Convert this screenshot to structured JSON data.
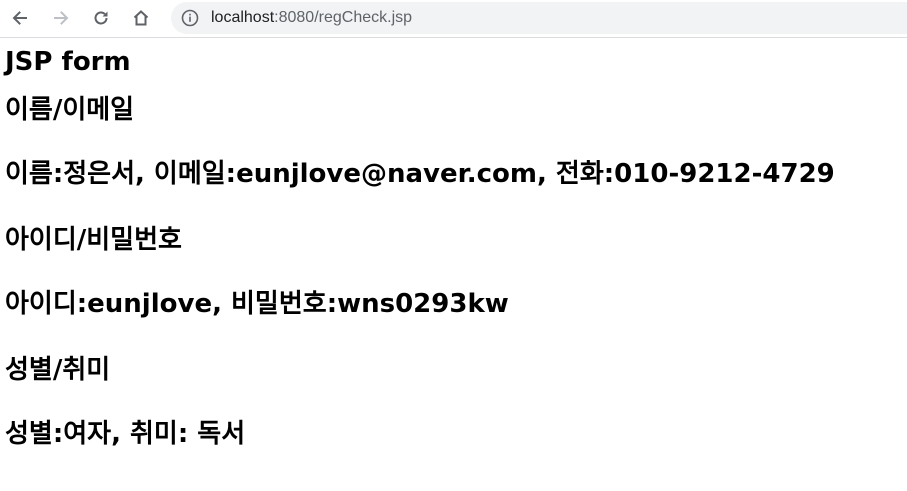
{
  "browser": {
    "url_host": "localhost",
    "url_rest": ":8080/regCheck.jsp",
    "icons": {
      "back": "arrow-left-icon",
      "forward": "arrow-right-icon",
      "reload": "reload-icon",
      "home": "home-icon",
      "site_info": "info-circle-icon"
    }
  },
  "page": {
    "title": "JSP form",
    "section_name_email": "이름/이메일",
    "name_email_line": "이름:정은서, 이메일:eunjlove@naver.com, 전화:010-9212-4729",
    "section_id_password": "아이디/비밀번호",
    "id_password_line": "아이디:eunjlove, 비밀번호:wns0293kw",
    "section_gender_hobby": "성별/취미",
    "gender_hobby_line": "성별:여자, 취미: 독서"
  }
}
